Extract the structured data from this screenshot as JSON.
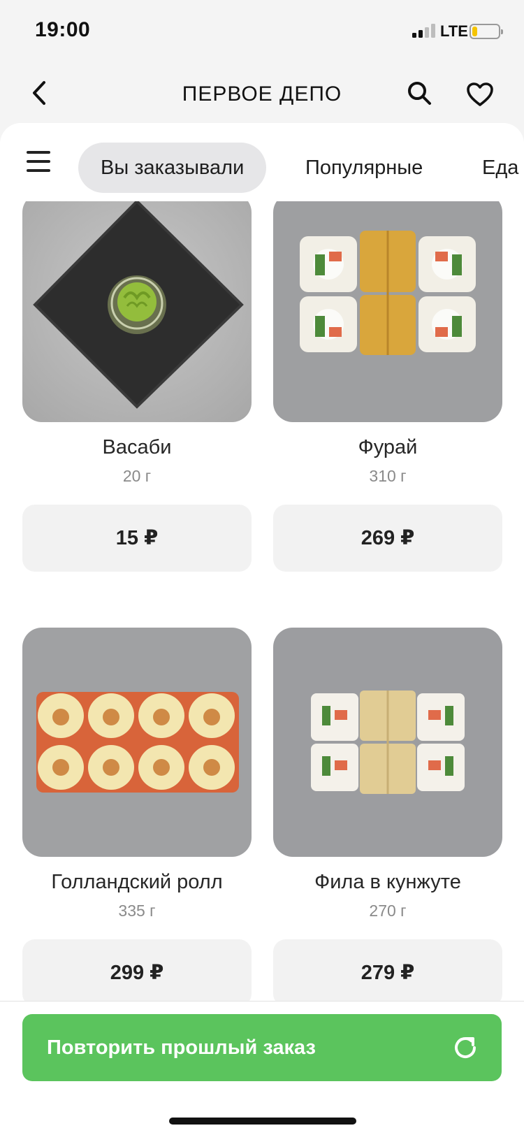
{
  "status_bar": {
    "time": "19:00",
    "network": "LTE",
    "battery_level": 0.2
  },
  "header": {
    "title": "ПЕРВОЕ ДЕПО",
    "back_icon": "chevron-left-icon",
    "search_icon": "search-icon",
    "favorite_icon": "heart-icon"
  },
  "tabs": [
    {
      "label": "Вы заказывали",
      "active": true
    },
    {
      "label": "Популярные",
      "active": false
    },
    {
      "label": "Еда",
      "active": false
    }
  ],
  "products": [
    {
      "name": "Васаби",
      "weight": "20 г",
      "price": "15 ₽"
    },
    {
      "name": "Фурай",
      "weight": "310 г",
      "price": "269 ₽"
    },
    {
      "name": "Голландский ролл",
      "weight": "335 г",
      "price": "299 ₽"
    },
    {
      "name": "Фила в кунжуте",
      "weight": "270 г",
      "price": "279 ₽"
    }
  ],
  "bottom": {
    "repeat_label": "Повторить прошлый заказ",
    "repeat_icon": "refresh-icon"
  },
  "colors": {
    "accent": "#5bc45d",
    "tab_active_bg": "#e6e6e8",
    "price_bg": "#f2f2f2"
  }
}
